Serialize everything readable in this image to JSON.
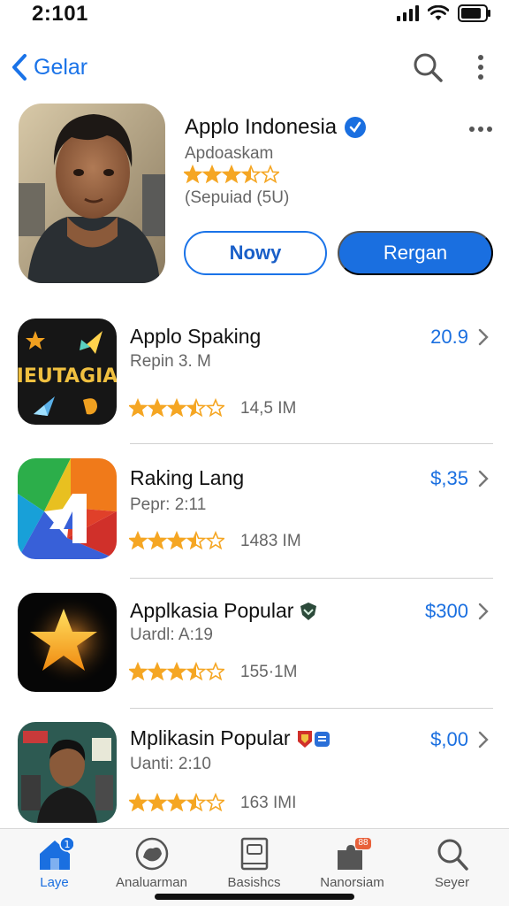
{
  "status": {
    "time": "2:101"
  },
  "nav": {
    "back_label": "Gelar"
  },
  "hero": {
    "title": "Applo Indonesia",
    "subtitle": "Apdoaskam",
    "rating": 3.5,
    "count": "(Sepuiad (5U)",
    "btn_secondary": "Nowy",
    "btn_primary": "Rergan"
  },
  "apps": [
    {
      "name": "Applo Spaking",
      "sub": "Repin 3. M",
      "size": "14,5 IM",
      "price": "20.9",
      "rating": 3.5,
      "icon_text": "IEUTAGIA"
    },
    {
      "name": "Raking Lang",
      "sub": "Pepr: 2:11",
      "size": "1483 IM",
      "price": "$,35",
      "rating": 3.5
    },
    {
      "name": "Applkasia Popular",
      "sub": "Uardl: A:19",
      "size": "155·1M",
      "price": "$300",
      "rating": 3.5
    },
    {
      "name": "Mplikasin Popular",
      "sub": "Uanti: 2:10",
      "size": "163 IMI",
      "price": "$,00",
      "rating": 3.5
    }
  ],
  "tabs": [
    {
      "label": "Laye",
      "active": true
    },
    {
      "label": "Analuarman"
    },
    {
      "label": "Basishcs"
    },
    {
      "label": "Nanorsiam",
      "badge": "88"
    },
    {
      "label": "Seyer"
    }
  ],
  "colors": {
    "accent": "#1a6fe0",
    "star": "#f5a623"
  }
}
